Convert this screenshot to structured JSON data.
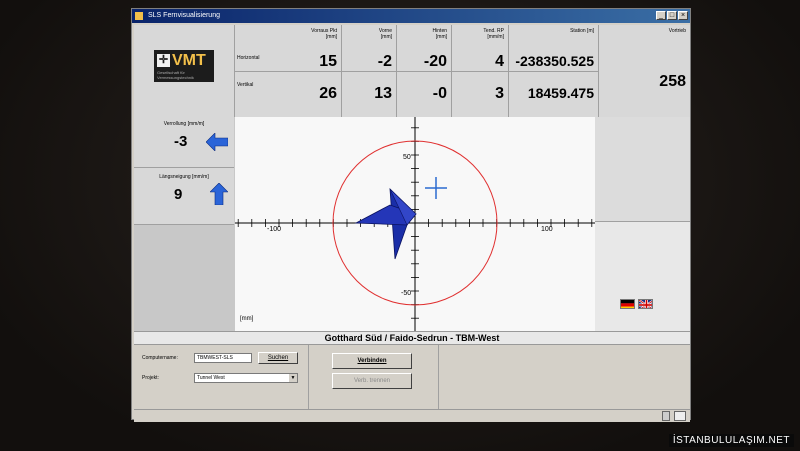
{
  "window": {
    "title": "SLS Fernvisualisierung",
    "controls": [
      "_",
      "□",
      "×"
    ]
  },
  "logo": {
    "brand": "VMT",
    "tagline": "Gesellschaft für Vermessungstechnik"
  },
  "header": {
    "columns": [
      {
        "label": "Vorraus Pkt",
        "unit": "[mm]",
        "horizontal": "15",
        "vertical": "26"
      },
      {
        "label": "Vorne",
        "unit": "[mm]",
        "horizontal": "-2",
        "vertical": "13"
      },
      {
        "label": "Hinten",
        "unit": "[mm]",
        "horizontal": "-20",
        "vertical": "-0"
      },
      {
        "label": "Tend. RP",
        "unit": "[mm/m]",
        "horizontal": "4",
        "vertical": "3"
      },
      {
        "label": "Station [m]",
        "unit": "",
        "horizontal": "-238350.525",
        "vertical": "18459.475"
      },
      {
        "label": "Vortrieb",
        "unit": "",
        "horizontal": "",
        "vertical": "258"
      }
    ],
    "row_labels": {
      "horizontal": "Horizontal",
      "vertical": "Vertikal"
    }
  },
  "left_panel": {
    "rolling": {
      "label": "Verrollung [mm/m]",
      "value": "-3"
    },
    "pitch": {
      "label": "Längsneigung [mm/m]",
      "value": "9"
    }
  },
  "plot": {
    "unit_label": "[mm]",
    "tick_labels": {
      "x_neg": "-100",
      "x_pos": "100",
      "y_pos": "50",
      "y_neg": "-50"
    },
    "colors": {
      "circle": "#e03030",
      "machine": "#1a2ea8",
      "cross": "#2a6ad0"
    }
  },
  "banner": {
    "text": "Gotthard Süd / Faido-Sedrun - TBM-West"
  },
  "form": {
    "computer_label": "Computername:",
    "computer_value": "TBMWEST-SLS",
    "search_button": "Suchen",
    "project_label": "Projekt:",
    "project_value": "Tunnel West",
    "connect_button": "Verbinden",
    "disconnect_button": "Verb. trennen"
  },
  "watermark": "İSTANBULULAŞIM.NET"
}
